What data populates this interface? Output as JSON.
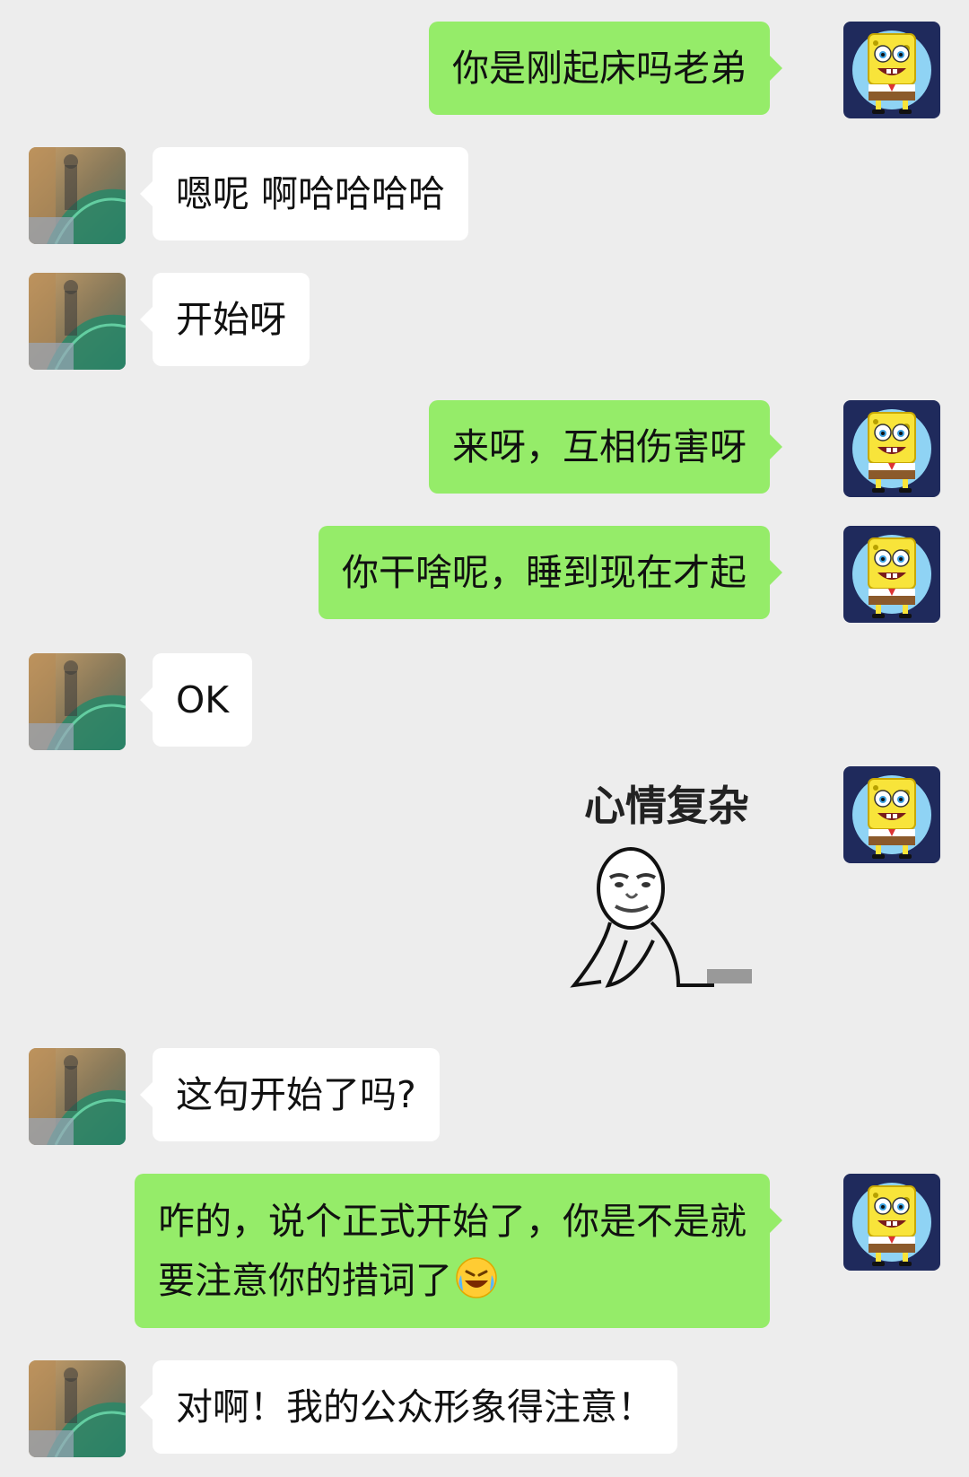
{
  "messages": [
    {
      "side": "out",
      "text": "你是刚起床吗老弟"
    },
    {
      "side": "in",
      "text": "嗯呢 啊哈哈哈哈"
    },
    {
      "side": "in",
      "text": "开始呀"
    },
    {
      "side": "out",
      "text": "来呀，互相伤害呀"
    },
    {
      "side": "out",
      "text": "你干啥呢，睡到现在才起"
    },
    {
      "side": "in",
      "text": "OK"
    },
    {
      "side": "out",
      "sticker": true,
      "caption": "心情复杂"
    },
    {
      "side": "in",
      "text": "这句开始了吗?"
    },
    {
      "side": "out",
      "lines": [
        "咋的，说个正式开始了，你是不是就",
        "要注意你的措词了"
      ],
      "emoji": "rolling-laughing-emoji"
    },
    {
      "side": "in",
      "text": "对啊！我的公众形象得注意！"
    }
  ],
  "colors": {
    "background": "#ededed",
    "outgoing_bubble": "#95ec69",
    "incoming_bubble": "#ffffff"
  },
  "icons": {
    "self_avatar": "spongebob-avatar-icon",
    "contact_avatar": "contact-photo-avatar-icon"
  }
}
